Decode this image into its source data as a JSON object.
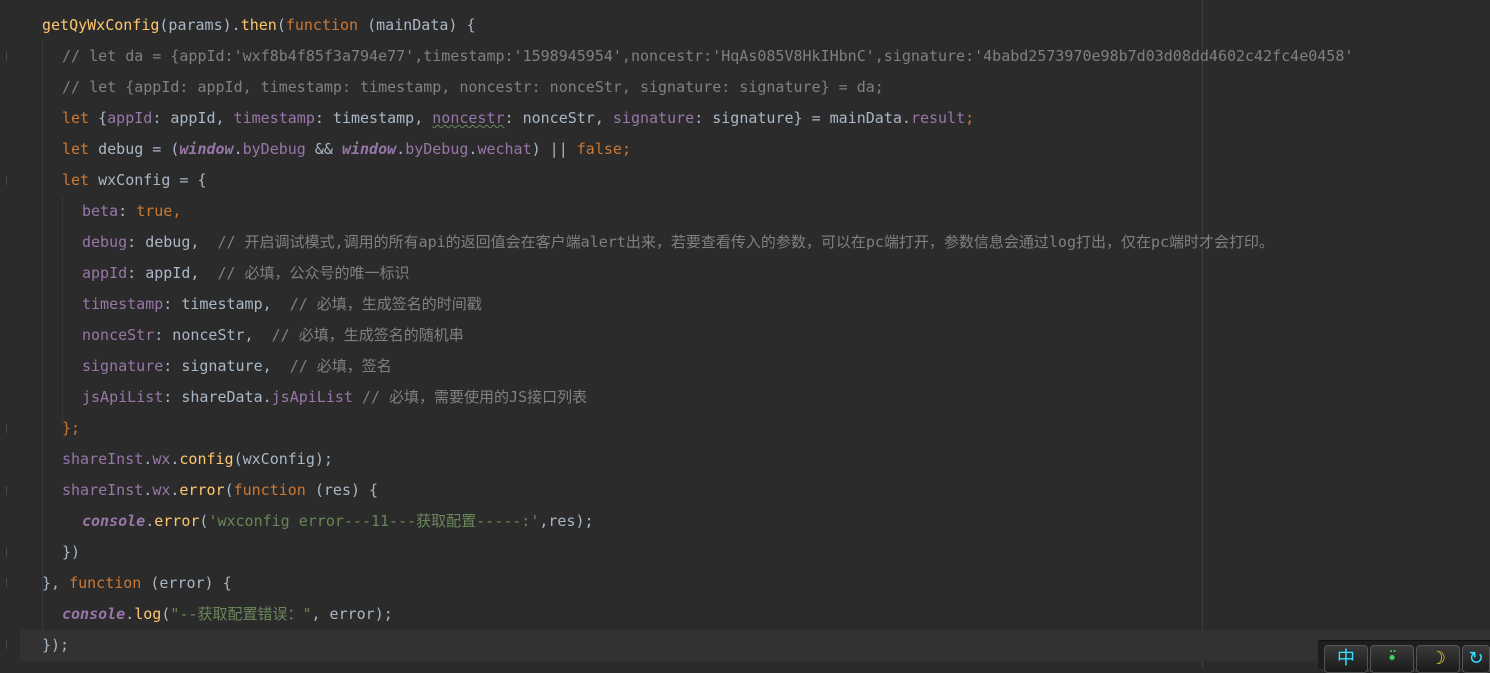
{
  "code": {
    "line1": {
      "a": "getQyWxConfig",
      "b": "(params).",
      "c": "then",
      "d": "(",
      "e": "function",
      "f": " (mainData) {"
    },
    "line2": "// let da = {appId:'wxf8b4f85f3a794e77',timestamp:'1598945954',noncestr:'HqAs085V8HkIHbnC',signature:'4babd2573970e98b7d03d08dd4602c42fc4e0458'",
    "line3": "// let {appId: appId, timestamp: timestamp, noncestr: nonceStr, signature: signature} = da;",
    "line4": {
      "kw": "let",
      "a": " {",
      "p1": "appId",
      "b": ": appId, ",
      "p2": "timestamp",
      "c": ": timestamp, ",
      "p3": "noncestr",
      "d": ": nonceStr, ",
      "p4": "signature",
      "e": ": signature} = mainData.",
      "p5": "result",
      "f": ";"
    },
    "line5": {
      "kw": "let",
      "a": " debug = (",
      "g1": "window",
      "b": ".",
      "p1": "byDebug",
      "c": " && ",
      "g2": "window",
      "d": ".",
      "p2": "byDebug",
      "e": ".",
      "p3": "wechat",
      "f": ") || ",
      "kw2": "false",
      "g": ";"
    },
    "line6": {
      "kw": "let",
      "a": " wxConfig = {"
    },
    "line7": {
      "p": "beta",
      "a": ": ",
      "v": "true",
      "b": ","
    },
    "line8": {
      "p": "debug",
      "a": ": debug,",
      "cm": "  // 开启调试模式,调用的所有api的返回值会在客户端alert出来，若要查看传入的参数，可以在pc端打开，参数信息会通过log打出，仅在pc端时才会打印。"
    },
    "line9": {
      "p": "appId",
      "a": ": appId,",
      "cm": "  // 必填，公众号的唯一标识"
    },
    "line10": {
      "p": "timestamp",
      "a": ": timestamp,",
      "cm": "  // 必填，生成签名的时间戳"
    },
    "line11": {
      "p": "nonceStr",
      "a": ": nonceStr,",
      "cm": "  // 必填，生成签名的随机串"
    },
    "line12": {
      "p": "signature",
      "a": ": signature,",
      "cm": "  // 必填，签名"
    },
    "line13": {
      "p": "jsApiList",
      "a": ": shareData.",
      "p2": "jsApiList",
      "cm": " // 必填，需要使用的JS接口列表"
    },
    "line14": "};",
    "line15": {
      "p1": "shareInst",
      "a": ".",
      "p2": "wx",
      "b": ".",
      "f": "config",
      "c": "(wxConfig);"
    },
    "line16": {
      "p1": "shareInst",
      "a": ".",
      "p2": "wx",
      "b": ".",
      "f": "error",
      "c": "(",
      "kw": "function",
      "d": " (res) {"
    },
    "line17": {
      "g": "console",
      "a": ".",
      "f": "error",
      "b": "(",
      "s": "'wxconfig error---11---获取配置-----:'",
      "c": ",res);"
    },
    "line18": "})",
    "line19": {
      "a": "}, ",
      "kw": "function",
      "b": " (error) {"
    },
    "line20": {
      "g": "console",
      "a": ".",
      "f": "log",
      "b": "(",
      "s": "\"--获取配置错误：\"",
      "c": ", error);"
    },
    "line21": "});"
  },
  "tray": {
    "btn1": "中",
    "btn2": "•̈",
    "btn3": "☽",
    "btn4": "↻"
  },
  "colors": {
    "background": "#2b2b2b",
    "keyword": "#cc7832",
    "function": "#ffc66d",
    "property": "#9876aa",
    "string": "#6a8759",
    "comment": "#808080"
  }
}
